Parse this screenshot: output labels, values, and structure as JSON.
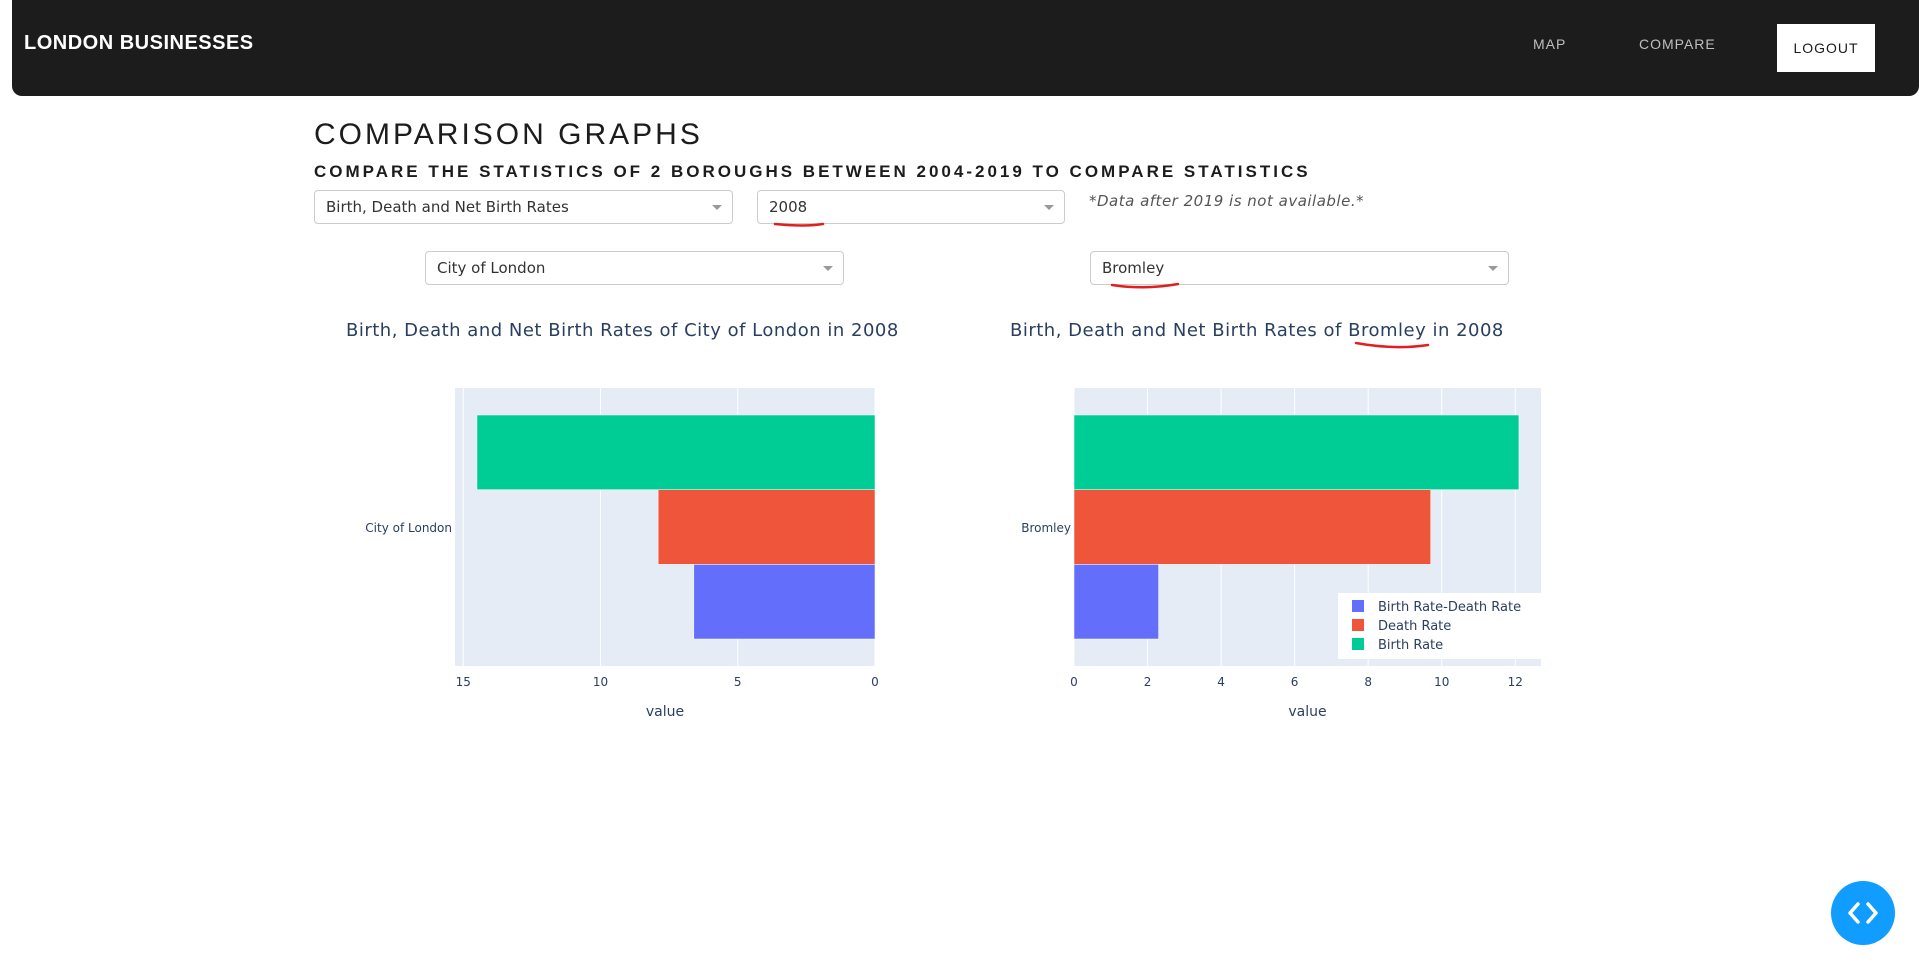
{
  "header": {
    "brand": "LONDON BUSINESSES",
    "nav": {
      "map": "MAP",
      "compare": "COMPARE"
    },
    "logout_label": "LOGOUT"
  },
  "main": {
    "title": "COMPARISON GRAPHS",
    "subtitle": "COMPARE THE STATISTICS OF 2 BOROUGHS BETWEEN 2004-2019 TO COMPARE STATISTICS",
    "statistic_select": "Birth, Death and Net Birth Rates",
    "year_select": "2008",
    "note": "*Data after 2019 is not available.*",
    "borough_left": "City of London",
    "borough_right": "Bromley"
  },
  "colors": {
    "birth_rate": "#00cc96",
    "death_rate": "#ef553b",
    "net_rate": "#636efa",
    "plot_bg": "#e5ecf6",
    "annotation_red": "#e02020",
    "fab": "#119dff"
  },
  "icons": {
    "fab": "code-icon"
  },
  "chart_data": [
    {
      "type": "bar",
      "orientation": "horizontal",
      "title": "Birth, Death and Net Birth Rates of City of London in 2008",
      "xlabel": "value",
      "ylabel": "",
      "category": "City of London",
      "x_reversed": true,
      "xlim": [
        0,
        15.3
      ],
      "xticks": [
        15,
        10,
        5,
        0
      ],
      "grid": true,
      "legend": "none",
      "series": [
        {
          "name": "Birth Rate-Death Rate",
          "values": [
            6.6
          ]
        },
        {
          "name": "Death Rate",
          "values": [
            7.9
          ]
        },
        {
          "name": "Birth Rate",
          "values": [
            14.5
          ]
        }
      ]
    },
    {
      "type": "bar",
      "orientation": "horizontal",
      "title": "Birth, Death and Net Birth Rates of Bromley in 2008",
      "xlabel": "value",
      "ylabel": "",
      "category": "Bromley",
      "x_reversed": false,
      "xlim": [
        0,
        12.7
      ],
      "xticks": [
        0,
        2,
        4,
        6,
        8,
        10,
        12
      ],
      "grid": true,
      "legend": "bottom-right",
      "series": [
        {
          "name": "Birth Rate-Death Rate",
          "values": [
            2.3
          ]
        },
        {
          "name": "Death Rate",
          "values": [
            9.7
          ]
        },
        {
          "name": "Birth Rate",
          "values": [
            12.1
          ]
        }
      ]
    }
  ]
}
